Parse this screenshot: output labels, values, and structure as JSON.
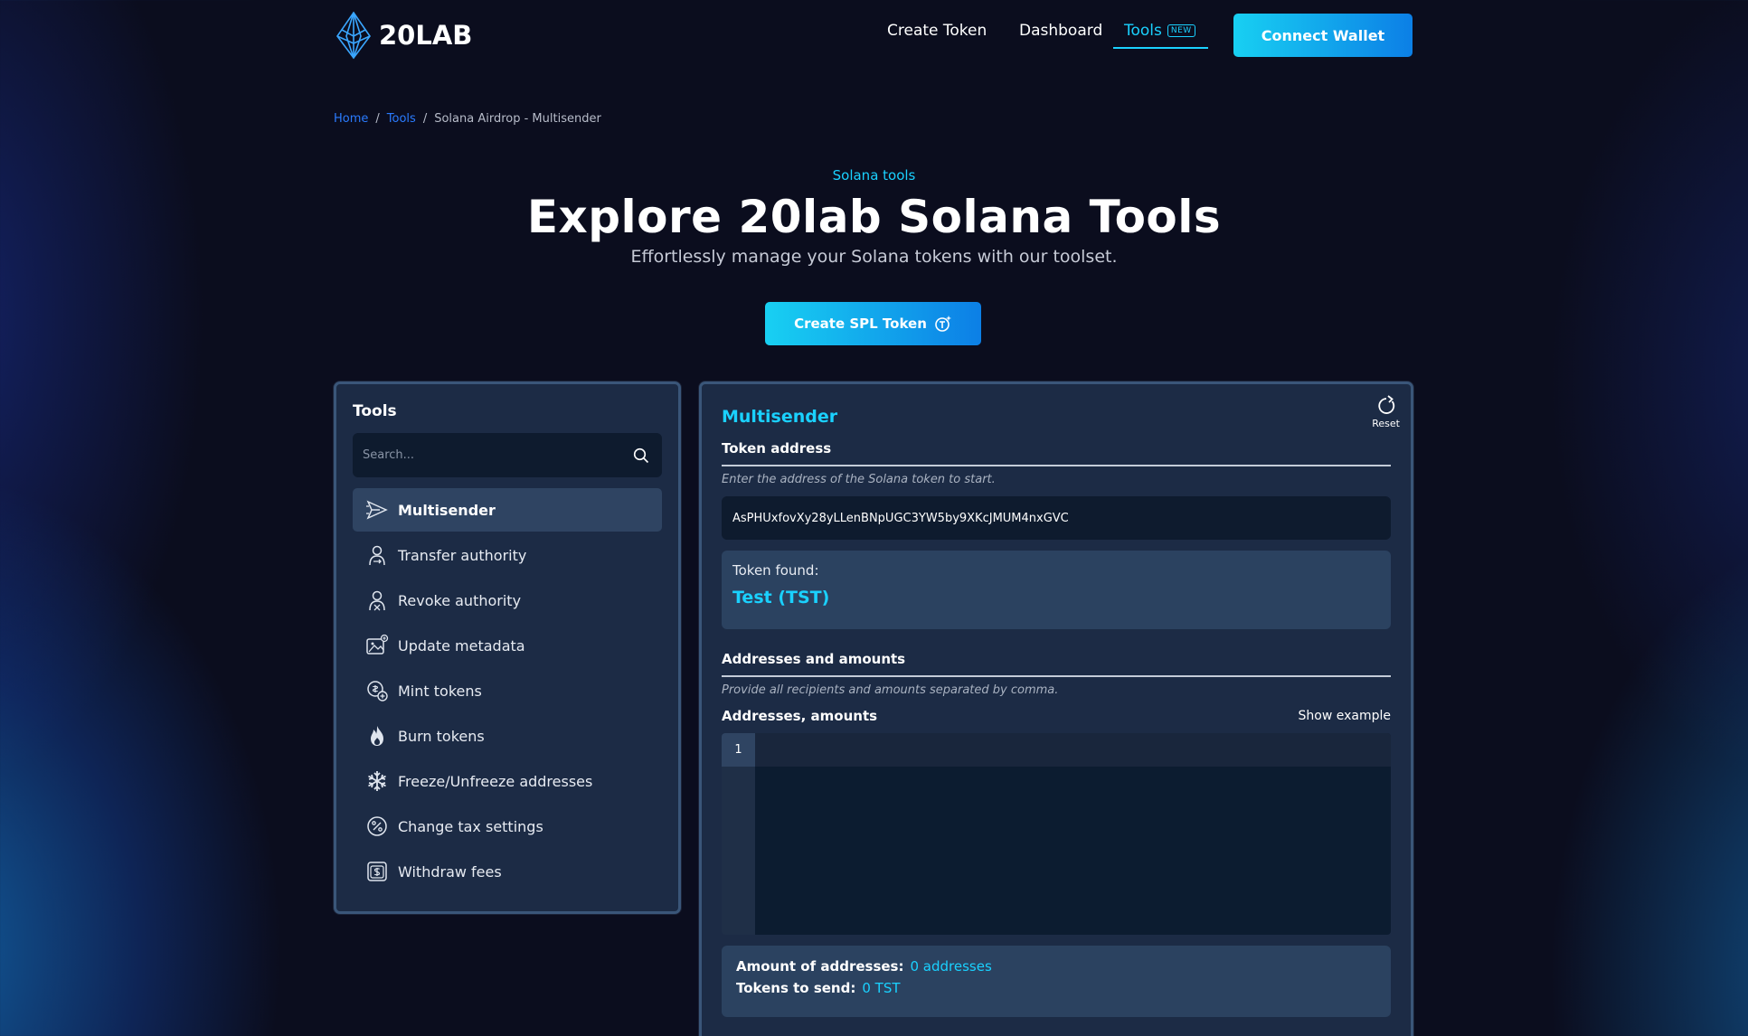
{
  "header": {
    "brand": "20LAB",
    "nav": {
      "create_token": "Create Token",
      "dashboard": "Dashboard",
      "tools": "Tools",
      "new_badge": "NEW"
    },
    "connect_wallet": "Connect Wallet"
  },
  "breadcrumb": {
    "home": "Home",
    "tools": "Tools",
    "current": "Solana Airdrop - Multisender",
    "separator": "/"
  },
  "hero": {
    "tag": "Solana tools",
    "title": "Explore 20lab Solana Tools",
    "subtitle": "Effortlessly manage your Solana tokens with our toolset.",
    "cta": "Create SPL Token"
  },
  "tools_panel": {
    "title": "Tools",
    "search_placeholder": "Search...",
    "items": [
      {
        "label": "Multisender",
        "icon": "send-icon",
        "active": true
      },
      {
        "label": "Transfer authority",
        "icon": "user-transfer-icon",
        "active": false
      },
      {
        "label": "Revoke authority",
        "icon": "user-revoke-icon",
        "active": false
      },
      {
        "label": "Update metadata",
        "icon": "image-edit-icon",
        "active": false
      },
      {
        "label": "Mint tokens",
        "icon": "coin-plus-icon",
        "active": false
      },
      {
        "label": "Burn tokens",
        "icon": "flame-icon",
        "active": false
      },
      {
        "label": "Freeze/Unfreeze addresses",
        "icon": "snowflake-icon",
        "active": false
      },
      {
        "label": "Change tax settings",
        "icon": "percent-icon",
        "active": false
      },
      {
        "label": "Withdraw fees",
        "icon": "dollar-box-icon",
        "active": false
      }
    ]
  },
  "multisender": {
    "title": "Multisender",
    "reset": "Reset",
    "token_address": {
      "label": "Token address",
      "hint": "Enter the address of the Solana token to start.",
      "value": "AsPHUxfovXy28yLLenBNpUGC3YW5by9XKcJMUM4nxGVC"
    },
    "token_found": {
      "label": "Token found:",
      "value": "Test (TST)"
    },
    "addresses": {
      "label": "Addresses and amounts",
      "hint": "Provide all recipients and amounts separated by comma.",
      "editor_label": "Addresses, amounts",
      "show_example": "Show example",
      "line_number": "1"
    },
    "summary": {
      "amount_label": "Amount of addresses:",
      "amount_value": "0 addresses",
      "tokens_label": "Tokens to send:",
      "tokens_value": "0 TST"
    }
  },
  "colors": {
    "accent": "#1ad1ff",
    "link": "#2a7bff",
    "panel": "#1c2b45",
    "background": "#0b0d1e"
  }
}
